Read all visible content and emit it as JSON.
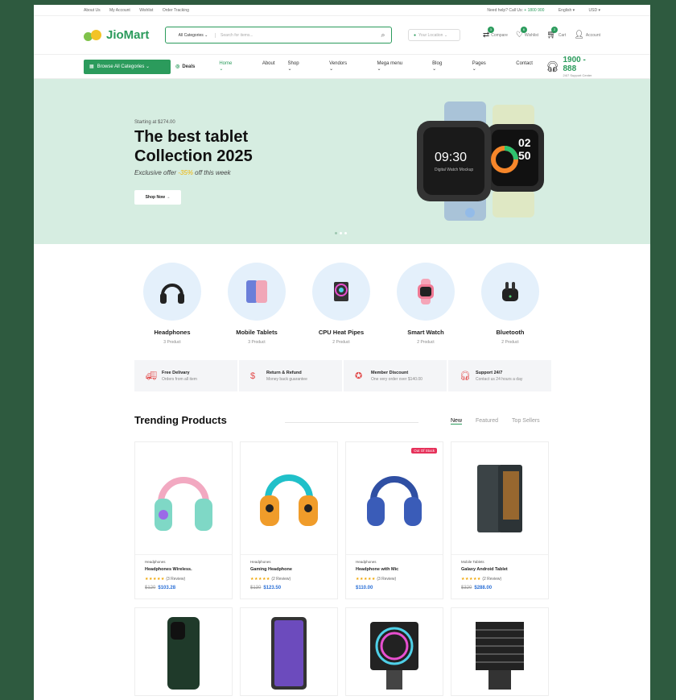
{
  "topbar": {
    "links": [
      "About Us",
      "My Account",
      "Wishlist",
      "Order Tracking"
    ],
    "help_text": "Need help? Call Us: ",
    "help_phone": "+ 1800 900",
    "language": "English",
    "currency": "USD"
  },
  "header": {
    "logo": "JioMart",
    "search_category": "All Categories",
    "search_placeholder": "Search for items...",
    "location_placeholder": "Your Location",
    "icons": [
      {
        "label": "Compare",
        "count": "3",
        "icon": "compare-icon"
      },
      {
        "label": "Wishlist",
        "count": "6",
        "icon": "heart-icon"
      },
      {
        "label": "Cart",
        "count": "2",
        "icon": "cart-icon"
      },
      {
        "label": "Account",
        "count": "",
        "icon": "user-icon"
      }
    ]
  },
  "nav": {
    "browse": "Browse All Categories",
    "deals": "Deals",
    "menu": [
      "Home",
      "About",
      "Shop",
      "Vendors",
      "Mega menu",
      "Blog",
      "Pages",
      "Contact"
    ],
    "active": "Home",
    "phone": "1900 - 888",
    "phone_sub": "24/7 Support Center"
  },
  "hero": {
    "starting": "Starting at $274.00",
    "title_line1": "The best tablet",
    "title_line2": "Collection 2025",
    "offer_prefix": "Exclusive offer ",
    "offer_pct": "-35%",
    "offer_suffix": " off this week",
    "button": "Shop Now",
    "watch1_time": "09:30",
    "watch1_text": "Digital Watch Mockup",
    "watch2_hour": "02",
    "watch2_min": "50"
  },
  "categories": [
    {
      "name": "Headphones",
      "count": "3 Product",
      "icon": "headphones-icon"
    },
    {
      "name": "Mobile Tablets",
      "count": "3 Product",
      "icon": "phone-icon"
    },
    {
      "name": "CPU Heat Pipes",
      "count": "2 Product",
      "icon": "cpu-cooler-icon"
    },
    {
      "name": "Smart Watch",
      "count": "2 Product",
      "icon": "watch-icon"
    },
    {
      "name": "Bluetooth",
      "count": "2 Product",
      "icon": "earbuds-icon"
    }
  ],
  "features": [
    {
      "title": "Free Delivary",
      "sub": "Orders from all item"
    },
    {
      "title": "Return & Refund",
      "sub": "Money back guarantee"
    },
    {
      "title": "Member Discount",
      "sub": "One very order over $140.00"
    },
    {
      "title": "Support 24/7",
      "sub": "Contact us 24 hours a day"
    }
  ],
  "trending": {
    "title": "Trending Products",
    "tabs": [
      "New",
      "Featured",
      "Top Sellers"
    ]
  },
  "products": [
    {
      "category": "Headphones",
      "name": "Headphones Wireless.",
      "stars": "★★★★★",
      "reviews": "(3 Review)",
      "old": "$120",
      "price": "$103.28",
      "badge": ""
    },
    {
      "category": "Headphones",
      "name": "Gaming Headphone",
      "stars": "★★★★★",
      "reviews": "(2 Review)",
      "old": "$130",
      "price": "$123.50",
      "badge": ""
    },
    {
      "category": "Headphones",
      "name": "Headphone with Mic",
      "stars": "★★★★★",
      "reviews": "(3 Review)",
      "old": "",
      "price": "$110.00",
      "badge": "Out Of Stock"
    },
    {
      "category": "Mobile Tablets",
      "name": "Galaxy Android Tablet",
      "stars": "★★★★★",
      "reviews": "(2 Review)",
      "old": "$320",
      "price": "$288.00",
      "badge": ""
    }
  ],
  "colors": {
    "brand": "#2b9b5c",
    "hero_bg": "#d6ede1",
    "badge": "#e6315a",
    "price": "#2a6fd6"
  }
}
